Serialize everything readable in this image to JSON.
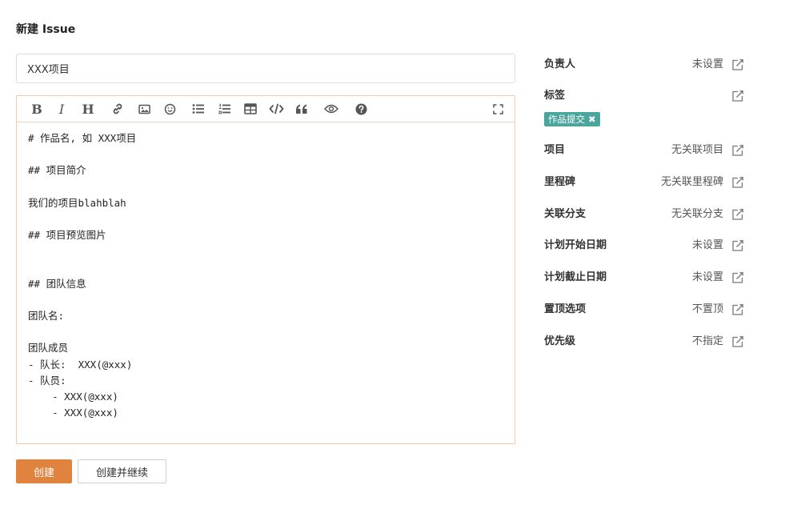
{
  "page": {
    "title": "新建 Issue"
  },
  "form": {
    "title_value": "XXX项目",
    "editor_lines": [
      "# 作品名, 如 XXX项目",
      "",
      "## 项目简介",
      "",
      "我们的项目blahblah",
      "",
      "## 项目预览图片",
      "",
      "",
      "## 团队信息",
      "",
      "团队名:",
      "",
      "团队成员",
      "- 队长:  XXX(@xxx)",
      "- 队员:",
      "    - XXX(@xxx)",
      "    - XXX(@xxx)"
    ],
    "toolbar": {
      "bold": "B",
      "italic": "I",
      "heading": "H",
      "icons": [
        "bold-icon",
        "italic-icon",
        "heading-icon",
        "link-icon",
        "image-icon",
        "emoji-icon",
        "unordered-list-icon",
        "ordered-list-icon",
        "table-icon",
        "code-icon",
        "quote-icon",
        "preview-icon",
        "help-icon",
        "fullscreen-icon"
      ]
    }
  },
  "buttons": {
    "create": "创建",
    "create_continue": "创建并继续"
  },
  "sidebar": {
    "assignee": {
      "label": "负责人",
      "value": "未设置"
    },
    "labels": {
      "label": "标签",
      "tag": "作品提交",
      "tag_remove": "✖"
    },
    "project": {
      "label": "项目",
      "value": "无关联项目"
    },
    "milestone": {
      "label": "里程碑",
      "value": "无关联里程碑"
    },
    "branch": {
      "label": "关联分支",
      "value": "无关联分支"
    },
    "start_date": {
      "label": "计划开始日期",
      "value": "未设置"
    },
    "due_date": {
      "label": "计划截止日期",
      "value": "未设置"
    },
    "pin": {
      "label": "置顶选项",
      "value": "不置顶"
    },
    "priority": {
      "label": "优先级",
      "value": "不指定"
    }
  },
  "colors": {
    "accent": "#e0833f",
    "tag": "#4aa59d",
    "editor_border": "#f5c9a6"
  }
}
